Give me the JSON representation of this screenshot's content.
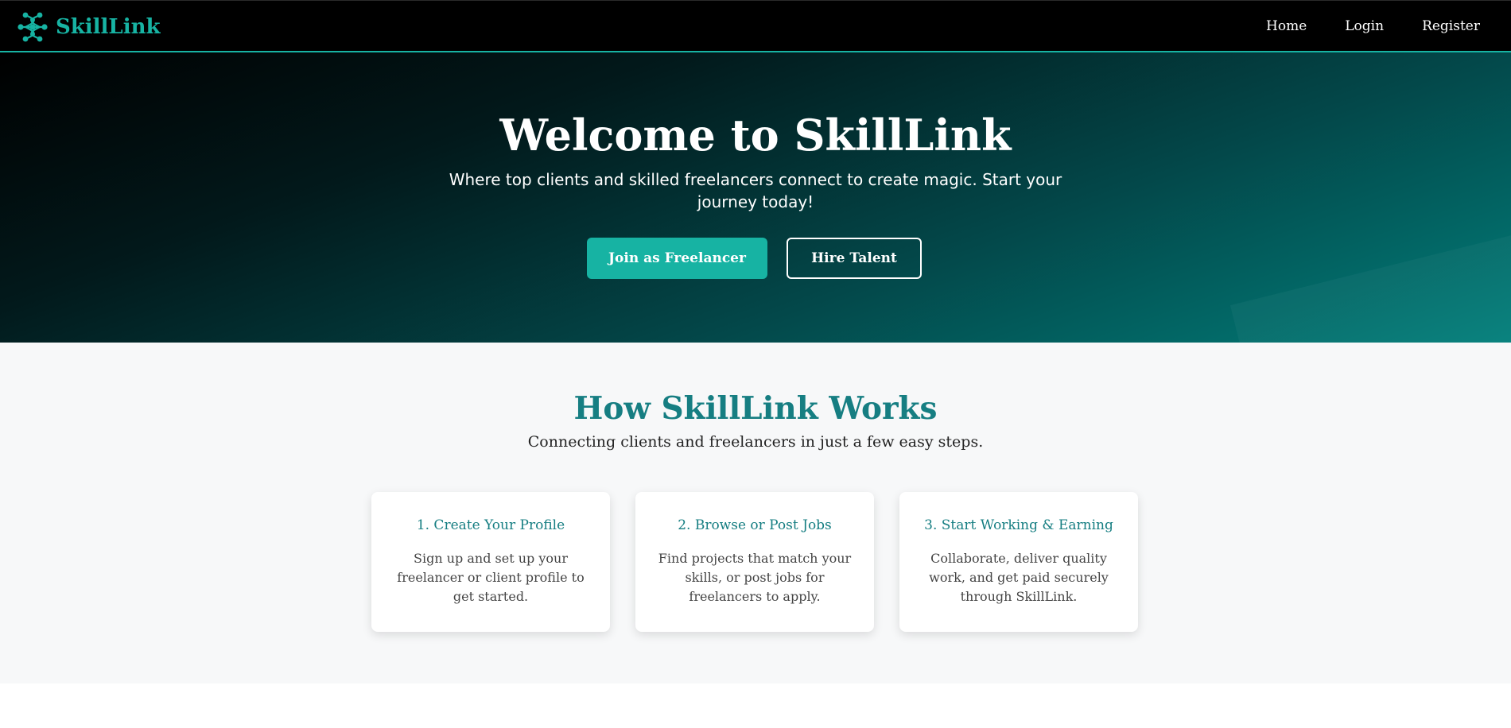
{
  "colors": {
    "accent": "#17b3a3",
    "heading_teal": "#167e82",
    "nav_background": "#000000",
    "section_background": "#f7f8f9"
  },
  "navbar": {
    "brand": "SkillLink",
    "logo_icon": "network-nodes-icon",
    "links": [
      {
        "label": "Home"
      },
      {
        "label": "Login"
      },
      {
        "label": "Register"
      }
    ]
  },
  "hero": {
    "title": "Welcome to SkillLink",
    "subtitle": "Where top clients and skilled freelancers connect to create magic. Start your journey today!",
    "primary_button": "Join as Freelancer",
    "secondary_button": "Hire Talent"
  },
  "how_it_works": {
    "title": "How SkillLink Works",
    "subtitle": "Connecting clients and freelancers in just a few easy steps.",
    "steps": [
      {
        "title": "1. Create Your Profile",
        "text": "Sign up and set up your freelancer or client profile to get started."
      },
      {
        "title": "2. Browse or Post Jobs",
        "text": "Find projects that match your skills, or post jobs for freelancers to apply."
      },
      {
        "title": "3. Start Working & Earning",
        "text": "Collaborate, deliver quality work, and get paid securely through SkillLink."
      }
    ]
  }
}
